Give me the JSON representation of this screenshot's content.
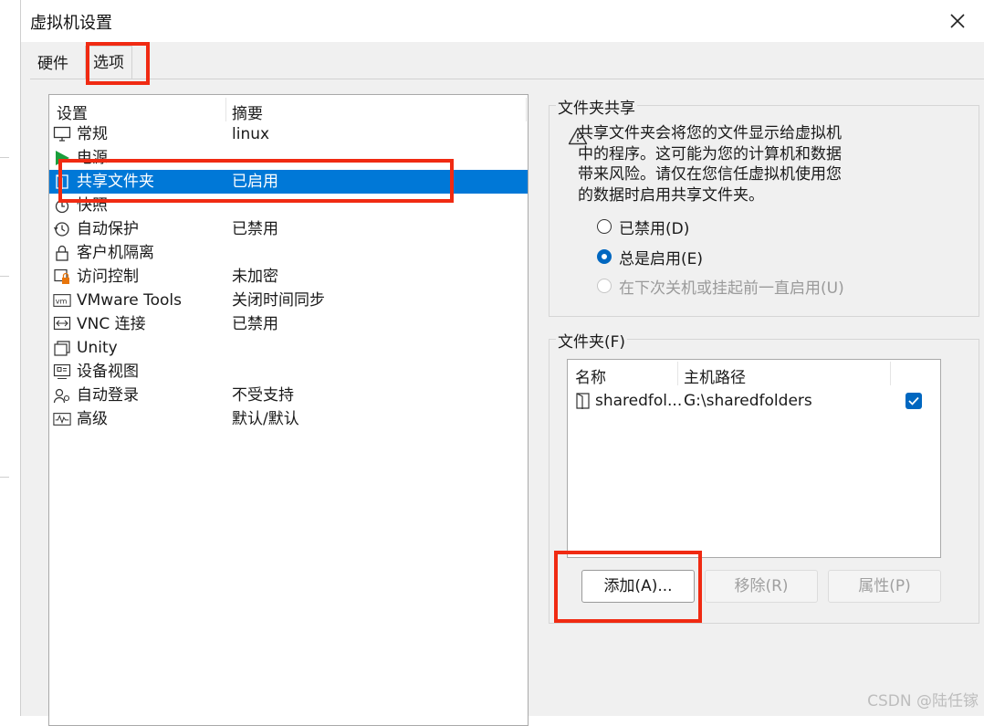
{
  "dialog": {
    "title": "虚拟机设置"
  },
  "tabs": [
    {
      "label": "硬件"
    },
    {
      "label": "选项"
    }
  ],
  "settings_list": {
    "headers": {
      "setting": "设置",
      "summary": "摘要"
    },
    "rows": [
      {
        "name": "常规",
        "summary": "linux",
        "icon": "monitor-icon"
      },
      {
        "name": "电源",
        "summary": "",
        "icon": "power-play-icon"
      },
      {
        "name": "共享文件夹",
        "summary": "已启用",
        "icon": "shared-folder-icon",
        "selected": true
      },
      {
        "name": "快照",
        "summary": "",
        "icon": "snapshot-icon"
      },
      {
        "name": "自动保护",
        "summary": "已禁用",
        "icon": "autoprotect-clock-icon"
      },
      {
        "name": "客户机隔离",
        "summary": "",
        "icon": "lock-icon"
      },
      {
        "name": "访问控制",
        "summary": "未加密",
        "icon": "access-control-icon"
      },
      {
        "name": "VMware Tools",
        "summary": "关闭时间同步",
        "icon": "vm-tools-icon"
      },
      {
        "name": "VNC 连接",
        "summary": "已禁用",
        "icon": "vnc-icon"
      },
      {
        "name": "Unity",
        "summary": "",
        "icon": "unity-icon"
      },
      {
        "name": "设备视图",
        "summary": "",
        "icon": "device-view-icon"
      },
      {
        "name": "自动登录",
        "summary": "不受支持",
        "icon": "autologin-user-icon"
      },
      {
        "name": "高级",
        "summary": "默认/默认",
        "icon": "advanced-waveform-icon"
      }
    ]
  },
  "folder_sharing": {
    "group_label": "文件夹共享",
    "warning_lines": [
      "共享文件夹会将您的文件显示给虚拟机",
      "中的程序。这可能为您的计算机和数据",
      "带来风险。请仅在您信任虚拟机使用您",
      "的数据时启用共享文件夹。"
    ],
    "options": [
      {
        "label": "已禁用(D)",
        "checked": false,
        "disabled": false
      },
      {
        "label": "总是启用(E)",
        "checked": true,
        "disabled": false
      },
      {
        "label": "在下次关机或挂起前一直启用(U)",
        "checked": false,
        "disabled": true
      }
    ]
  },
  "folders": {
    "group_label": "文件夹(F)",
    "headers": {
      "name": "名称",
      "path": "主机路径"
    },
    "rows": [
      {
        "name": "sharedfol...",
        "path": "G:\\sharedfolders",
        "enabled": true
      }
    ],
    "buttons": {
      "add": "添加(A)...",
      "remove": "移除(R)",
      "properties": "属性(P)"
    }
  },
  "watermark": "CSDN @陆任镓",
  "colors": {
    "selection": "#0078d7",
    "annotation": "#f02a12",
    "accent": "#0067c0"
  }
}
